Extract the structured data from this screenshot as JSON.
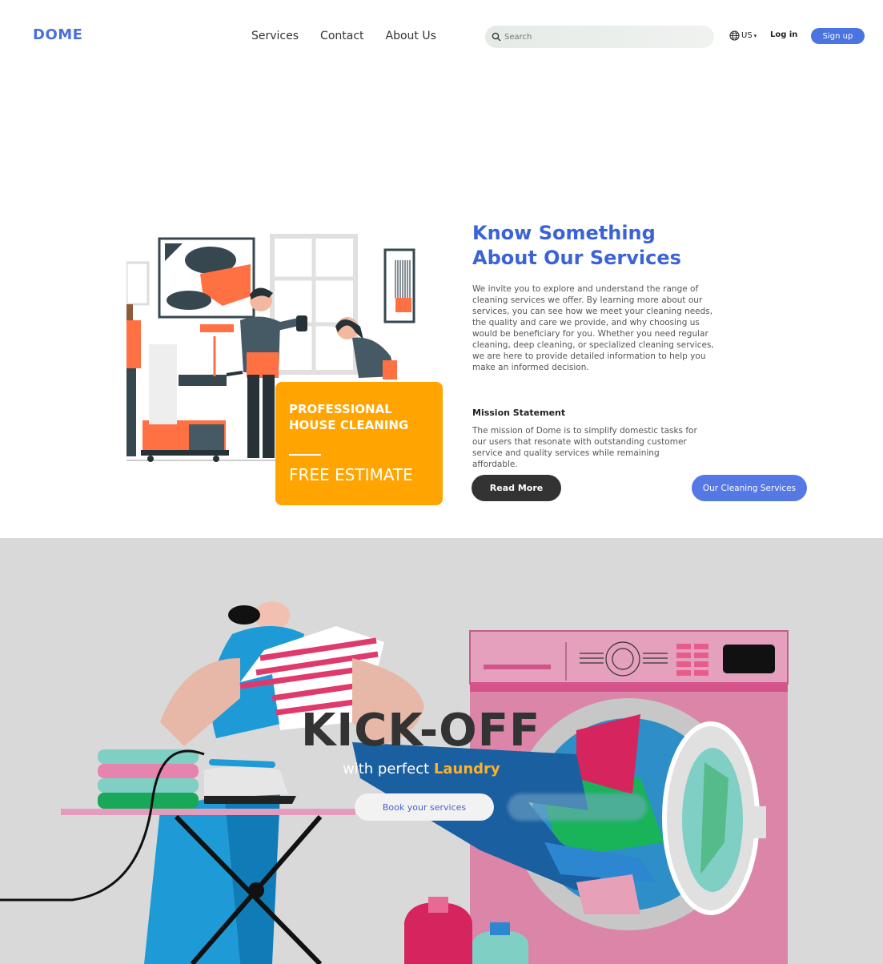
{
  "header": {
    "logo": "DOME",
    "nav": [
      "Services",
      "Contact",
      "About Us"
    ],
    "search_placeholder": "Search",
    "lang": "US",
    "login": "Log in",
    "signup": "Sign up"
  },
  "about": {
    "title_line1": "Know Something",
    "title_line2": "About Our Services",
    "description": "We invite you to explore and understand the range of cleaning services we offer. By learning more about our services, you can see how we meet your cleaning needs, the quality and care we provide, and why choosing us would be beneficiary for you. Whether you need regular cleaning, deep cleaning, or specialized cleaning services, we are here to provide detailed information to help you make an informed decision.",
    "mission_heading": "Mission Statement",
    "mission_text": "The mission of Dome is to simplify domestic tasks for our users that resonate with outstanding customer service and quality services while remaining affordable.",
    "read_more": "Read More",
    "our_services": "Our Cleaning Services",
    "promo_line1": "PROFESSIONAL HOUSE CLEANING",
    "promo_line2": "FREE ESTIMATE"
  },
  "hero": {
    "headline": "KICK-OFF",
    "tagline_prefix": "with perfect",
    "tagline_highlight": "Laundry",
    "book_button": "Book your services"
  },
  "colors": {
    "brand_blue": "#4a6fdc",
    "promo_orange": "#ffa400",
    "hero_bg": "#d9d9d9",
    "highlight_yellow": "#ffb12b"
  }
}
